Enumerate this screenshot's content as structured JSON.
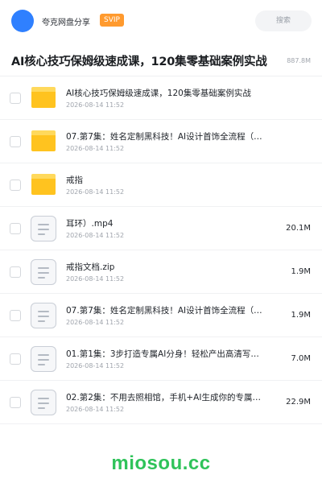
{
  "header": {
    "user_name": "夸克网盘分享",
    "badge": "SVIP",
    "search_placeholder": "搜索"
  },
  "share": {
    "title": "AI核心技巧保姆级速成课，120集零基础案例实战",
    "meta": "887.8M"
  },
  "files": [
    {
      "type": "folder",
      "name": "AI核心技巧保姆级速成课，120集零基础案例实战",
      "date": "2026-08-14 11:52",
      "size": ""
    },
    {
      "type": "folder",
      "name": "07.第7集：姓名定制黑科技！AI设计首饰全流程（…",
      "date": "2026-08-14 11:52",
      "size": ""
    },
    {
      "type": "folder",
      "name": "戒指",
      "date": "2026-08-14 11:52",
      "size": ""
    },
    {
      "type": "file",
      "name": "耳环）.mp4",
      "date": "2026-08-14 11:52",
      "size": "20.1M"
    },
    {
      "type": "file",
      "name": "戒指文档.zip",
      "date": "2026-08-14 11:52",
      "size": "1.9M"
    },
    {
      "type": "file",
      "name": "07.第7集：姓名定制黑科技！AI设计首饰全流程（…",
      "date": "2026-08-14 11:52",
      "size": "1.9M"
    },
    {
      "type": "file",
      "name": "01.第1集：3步打造专属AI分身！轻松产出高清写…",
      "date": "2026-08-14 11:52",
      "size": "7.0M"
    },
    {
      "type": "file",
      "name": "02.第2集：不用去照相馆，手机+AI生成你的专属…",
      "date": "2026-08-14 11:52",
      "size": "22.9M"
    }
  ],
  "watermark": "miosou.cc",
  "icons": {
    "folder": "folder-icon",
    "file": "document-icon"
  },
  "colors": {
    "accent": "#2f80ff",
    "badge": "#ff9a2e",
    "folder": "#ffc31f",
    "watermark": "#2fc35a"
  }
}
